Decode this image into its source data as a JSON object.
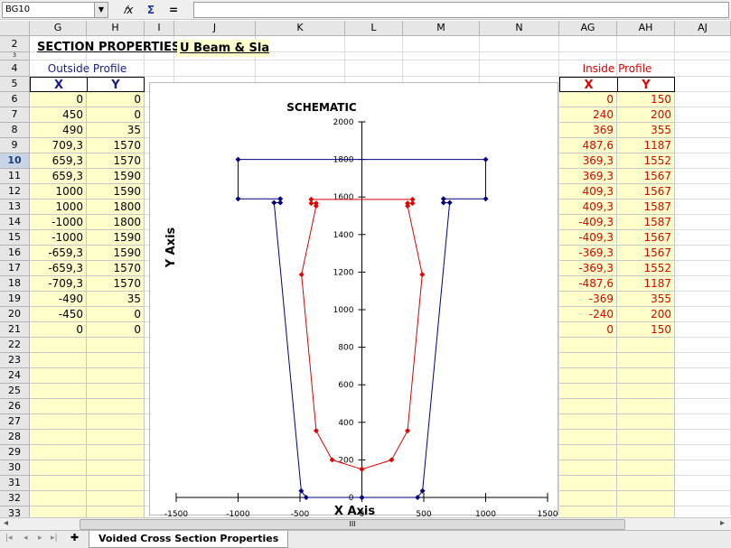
{
  "toolbar": {
    "name_box": "BG10",
    "fx_label": "𝑓x",
    "sum_label": "Σ",
    "equals_label": "="
  },
  "columns": [
    {
      "label": "G",
      "left": 33,
      "width": 63
    },
    {
      "label": "H",
      "left": 96,
      "width": 64
    },
    {
      "label": "I",
      "left": 160,
      "width": 33
    },
    {
      "label": "J",
      "left": 193,
      "width": 90
    },
    {
      "label": "K",
      "left": 283,
      "width": 99
    },
    {
      "label": "L",
      "left": 382,
      "width": 64
    },
    {
      "label": "M",
      "left": 446,
      "width": 85
    },
    {
      "label": "N",
      "left": 531,
      "width": 88
    },
    {
      "label": "AG",
      "left": 619,
      "width": 64
    },
    {
      "label": "AH",
      "left": 683,
      "width": 64
    },
    {
      "label": "AJ",
      "left": 747,
      "width": 62
    }
  ],
  "rows": [
    "2",
    "3",
    "4",
    "5",
    "6",
    "7",
    "8",
    "9",
    "10",
    "11",
    "12",
    "13",
    "14",
    "15",
    "16",
    "17",
    "18",
    "19",
    "20",
    "21",
    "22",
    "23",
    "24",
    "25",
    "26",
    "27",
    "28",
    "29",
    "30",
    "31",
    "32",
    "33"
  ],
  "selected_row": "10",
  "sheet": {
    "title_label": "SECTION PROPERTIES :",
    "title_value": "U Beam & Slab",
    "outside_label": "Outside Profile",
    "inside_label": "Inside Profile",
    "x_header": "X",
    "y_header": "Y",
    "outside": [
      [
        "0",
        "0"
      ],
      [
        "450",
        "0"
      ],
      [
        "490",
        "35"
      ],
      [
        "709,3",
        "1570"
      ],
      [
        "659,3",
        "1570"
      ],
      [
        "659,3",
        "1590"
      ],
      [
        "1000",
        "1590"
      ],
      [
        "1000",
        "1800"
      ],
      [
        "-1000",
        "1800"
      ],
      [
        "-1000",
        "1590"
      ],
      [
        "-659,3",
        "1590"
      ],
      [
        "-659,3",
        "1570"
      ],
      [
        "-709,3",
        "1570"
      ],
      [
        "-490",
        "35"
      ],
      [
        "-450",
        "0"
      ],
      [
        "0",
        "0"
      ]
    ],
    "inside": [
      [
        "0",
        "150"
      ],
      [
        "240",
        "200"
      ],
      [
        "369",
        "355"
      ],
      [
        "487,6",
        "1187"
      ],
      [
        "369,3",
        "1552"
      ],
      [
        "369,3",
        "1567"
      ],
      [
        "409,3",
        "1567"
      ],
      [
        "409,3",
        "1587"
      ],
      [
        "-409,3",
        "1587"
      ],
      [
        "-409,3",
        "1567"
      ],
      [
        "-369,3",
        "1567"
      ],
      [
        "-369,3",
        "1552"
      ],
      [
        "-487,6",
        "1187"
      ],
      [
        "-369",
        "355"
      ],
      [
        "-240",
        "200"
      ],
      [
        "0",
        "150"
      ]
    ]
  },
  "chart_data": {
    "type": "scatter",
    "title": "SCHEMATIC",
    "xlabel": "X Axis",
    "ylabel": "Y Axis",
    "xlim": [
      -1500,
      1500
    ],
    "ylim": [
      0,
      2000
    ],
    "x_ticks": [
      "-1500",
      "-1000",
      "-500",
      "0",
      "500",
      "1000",
      "1500"
    ],
    "y_ticks": [
      "0",
      "200",
      "400",
      "600",
      "800",
      "1000",
      "1200",
      "1400",
      "1600",
      "1800",
      "2000"
    ],
    "grid": false,
    "series": [
      {
        "color": "#00007f",
        "points": [
          [
            0,
            0
          ],
          [
            450,
            0
          ],
          [
            490,
            35
          ],
          [
            709.3,
            1570
          ],
          [
            659.3,
            1570
          ],
          [
            659.3,
            1590
          ],
          [
            1000,
            1590
          ],
          [
            1000,
            1800
          ],
          [
            -1000,
            1800
          ],
          [
            -1000,
            1590
          ],
          [
            -659.3,
            1590
          ],
          [
            -659.3,
            1570
          ],
          [
            -709.3,
            1570
          ],
          [
            -490,
            35
          ],
          [
            -450,
            0
          ],
          [
            0,
            0
          ]
        ]
      },
      {
        "color": "#e00000",
        "points": [
          [
            0,
            150
          ],
          [
            240,
            200
          ],
          [
            369,
            355
          ],
          [
            487.6,
            1187
          ],
          [
            369.3,
            1552
          ],
          [
            369.3,
            1567
          ],
          [
            409.3,
            1567
          ],
          [
            409.3,
            1587
          ],
          [
            -409.3,
            1587
          ],
          [
            -409.3,
            1567
          ],
          [
            -369.3,
            1567
          ],
          [
            -369.3,
            1552
          ],
          [
            -487.6,
            1187
          ],
          [
            -369,
            355
          ],
          [
            -240,
            200
          ],
          [
            0,
            150
          ]
        ]
      }
    ]
  },
  "tabs": {
    "add_label": "✚",
    "sheet_name": "Voided Cross Section Properties"
  },
  "scroll": {
    "left_arrow": "◂",
    "right_arrow": "▸",
    "thumb_grip": "III"
  }
}
